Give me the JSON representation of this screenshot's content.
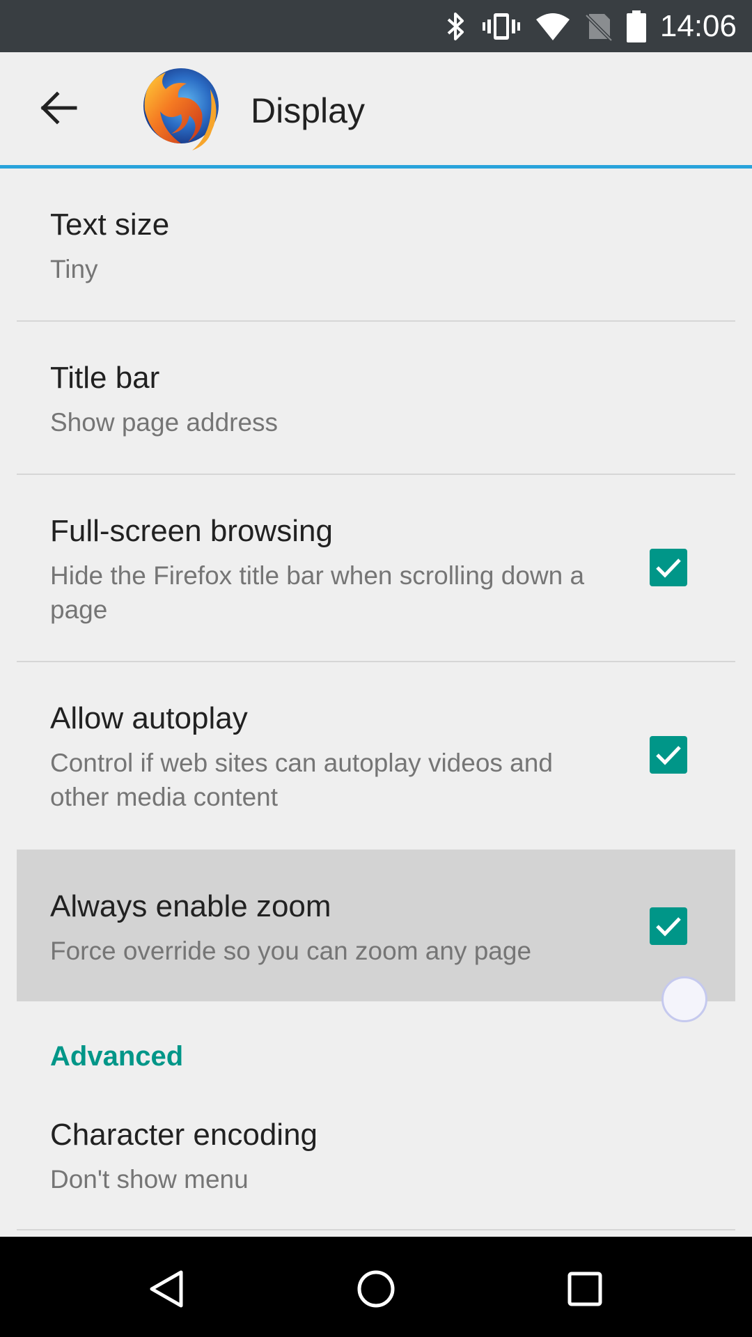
{
  "status_bar": {
    "time": "14:06",
    "icons": [
      "bluetooth-icon",
      "vibrate-icon",
      "wifi-icon",
      "no-sim-icon",
      "battery-icon"
    ]
  },
  "app_bar": {
    "title": "Display",
    "back_icon": "back-arrow-icon",
    "logo": "firefox-logo",
    "accent_color": "#29a3db"
  },
  "preferences": [
    {
      "title": "Text size",
      "summary": "Tiny"
    },
    {
      "title": "Title bar",
      "summary": "Show page address"
    },
    {
      "title": "Full-screen browsing",
      "summary": "Hide the Firefox title bar when scrolling down a page",
      "checked": true
    },
    {
      "title": "Allow autoplay",
      "summary": "Control if web sites can autoplay videos and other media content",
      "checked": true
    },
    {
      "title": "Always enable zoom",
      "summary": "Force override so you can zoom any page",
      "checked": true,
      "pressed": true
    }
  ],
  "advanced": {
    "header": "Advanced",
    "items": [
      {
        "title": "Character encoding",
        "summary": "Don't show menu"
      }
    ]
  },
  "colors": {
    "checkbox": "#009688",
    "section_header": "#009688",
    "status_bar": "#393e42"
  },
  "nav_bar": {
    "buttons": [
      "back-nav-icon",
      "home-nav-icon",
      "recents-nav-icon"
    ]
  }
}
